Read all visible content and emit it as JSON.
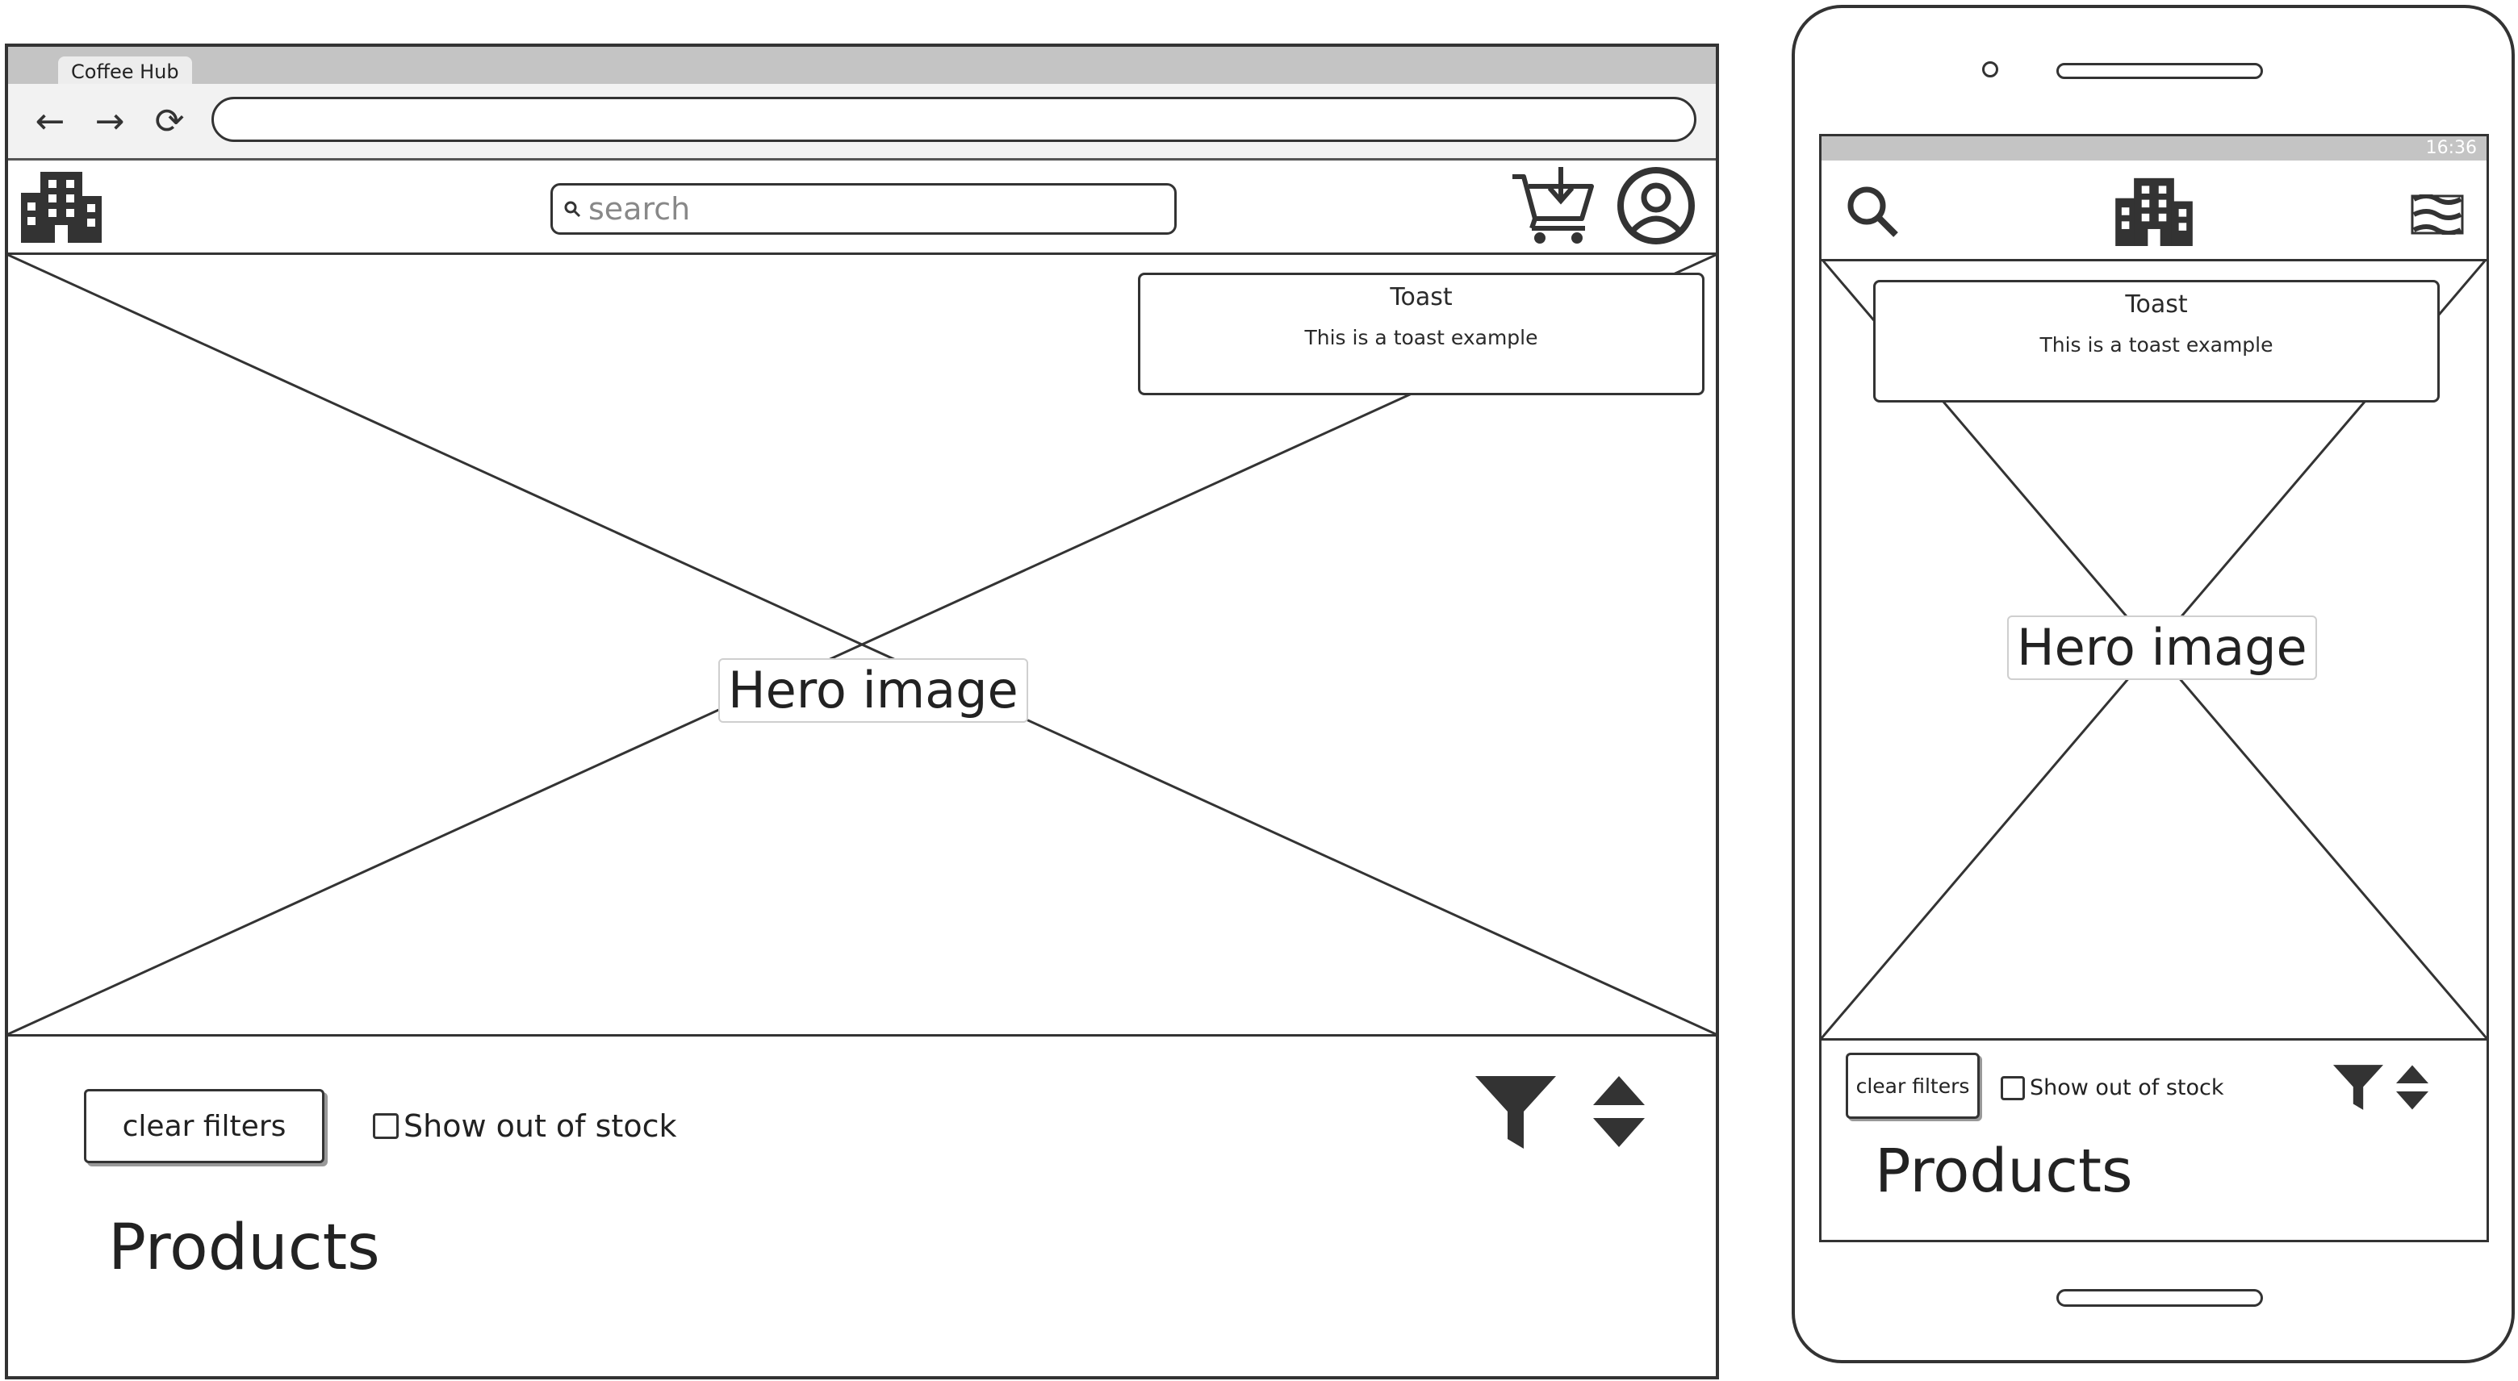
{
  "desktop": {
    "tab_title": "Coffee Hub",
    "nav": {
      "back_icon": "←",
      "forward_icon": "→",
      "reload_icon": "⟳"
    },
    "url": "",
    "search": {
      "icon": "search-icon",
      "placeholder": "search"
    },
    "icons": [
      "building-logo-icon",
      "cart-download-icon",
      "account-circle-icon"
    ],
    "hero": {
      "label": "Hero image"
    },
    "toast": {
      "title": "Toast",
      "message": "This is a toast example"
    },
    "filters": {
      "clear_label": "clear filters",
      "out_of_stock_label": "Show out of stock",
      "out_of_stock_checked": false
    },
    "products_heading": "Products"
  },
  "phone": {
    "status_time": "16:36",
    "icons": [
      "search-icon",
      "building-logo-icon",
      "menu-icon",
      "funnel-icon",
      "sort-icon"
    ],
    "hero": {
      "label": "Hero image"
    },
    "toast": {
      "title": "Toast",
      "message": "This is a toast example"
    },
    "filters": {
      "clear_label": "clear filters",
      "out_of_stock_label": "Show out of stock",
      "out_of_stock_checked": false
    },
    "products_heading": "Products"
  }
}
